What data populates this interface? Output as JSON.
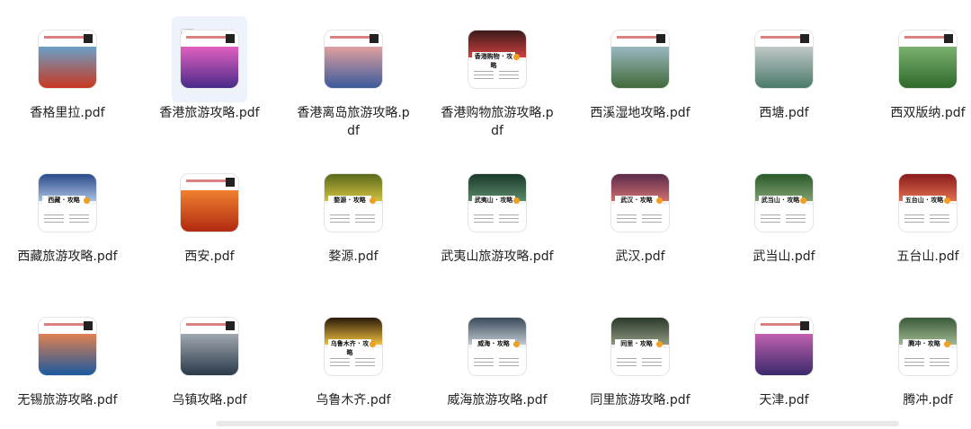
{
  "files": [
    {
      "name": "香格里拉.pdf",
      "style": "cover",
      "colors": [
        "#c9371f",
        "#6aa0c8"
      ]
    },
    {
      "name": "香港旅游攻略.pdf",
      "style": "cover",
      "colors": [
        "#4a2a8a",
        "#e060c0"
      ],
      "selected": true
    },
    {
      "name": "香港离岛旅游攻略.pdf",
      "style": "cover",
      "colors": [
        "#3a5a9a",
        "#e0a0a0"
      ]
    },
    {
      "name": "香港购物旅游攻略.pdf",
      "style": "guide",
      "colors": [
        "#3a1a1a",
        "#d04040"
      ],
      "caption": "香港购物 · 攻略"
    },
    {
      "name": "西溪湿地攻略.pdf",
      "style": "cover",
      "colors": [
        "#3f6a3a",
        "#9ab8c0"
      ]
    },
    {
      "name": "西塘.pdf",
      "style": "cover",
      "colors": [
        "#4a7a6a",
        "#c0c8c8"
      ]
    },
    {
      "name": "西双版纳.pdf",
      "style": "cover",
      "colors": [
        "#2f6a2a",
        "#7ab070"
      ]
    },
    {
      "name": "西藏旅游攻略.pdf",
      "style": "guide",
      "colors": [
        "#2a4a8a",
        "#a8c0e0"
      ],
      "caption": "西藏 · 攻略"
    },
    {
      "name": "西安.pdf",
      "style": "cover",
      "colors": [
        "#b02a10",
        "#f08030"
      ]
    },
    {
      "name": "婺源.pdf",
      "style": "guide",
      "colors": [
        "#5a6a1a",
        "#d0c040"
      ],
      "caption": "婺源 · 攻略"
    },
    {
      "name": "武夷山旅游攻略.pdf",
      "style": "guide",
      "colors": [
        "#1a3a2a",
        "#5a8a6a"
      ],
      "caption": "武夷山 · 攻略"
    },
    {
      "name": "武汉.pdf",
      "style": "guide",
      "colors": [
        "#5a2a4a",
        "#d07070"
      ],
      "caption": "武汉 · 攻略"
    },
    {
      "name": "武当山.pdf",
      "style": "guide",
      "colors": [
        "#2a5a2a",
        "#80a070"
      ],
      "caption": "武当山 · 攻略"
    },
    {
      "name": "五台山.pdf",
      "style": "guide",
      "colors": [
        "#8a1a1a",
        "#e07050"
      ],
      "caption": "五台山 · 攻略"
    },
    {
      "name": "无锡旅游攻略.pdf",
      "style": "cover",
      "colors": [
        "#1a5aa0",
        "#e08050"
      ]
    },
    {
      "name": "乌镇攻略.pdf",
      "style": "cover",
      "colors": [
        "#2a3a4a",
        "#a0a8b0"
      ]
    },
    {
      "name": "乌鲁木齐.pdf",
      "style": "guide",
      "colors": [
        "#2a1a0a",
        "#f0c040"
      ],
      "caption": "乌鲁木齐 · 攻略"
    },
    {
      "name": "威海旅游攻略.pdf",
      "style": "guide",
      "colors": [
        "#3a4a5a",
        "#c0c8d0"
      ],
      "caption": "威海 · 攻略"
    },
    {
      "name": "同里旅游攻略.pdf",
      "style": "guide",
      "colors": [
        "#2a3a2a",
        "#909880"
      ],
      "caption": "同里 · 攻略"
    },
    {
      "name": "天津.pdf",
      "style": "cover",
      "colors": [
        "#3a2a6a",
        "#c060b0"
      ]
    },
    {
      "name": "腾冲.pdf",
      "style": "guide",
      "colors": [
        "#3a5a3a",
        "#a0b890"
      ],
      "caption": "腾冲 · 攻略"
    }
  ]
}
